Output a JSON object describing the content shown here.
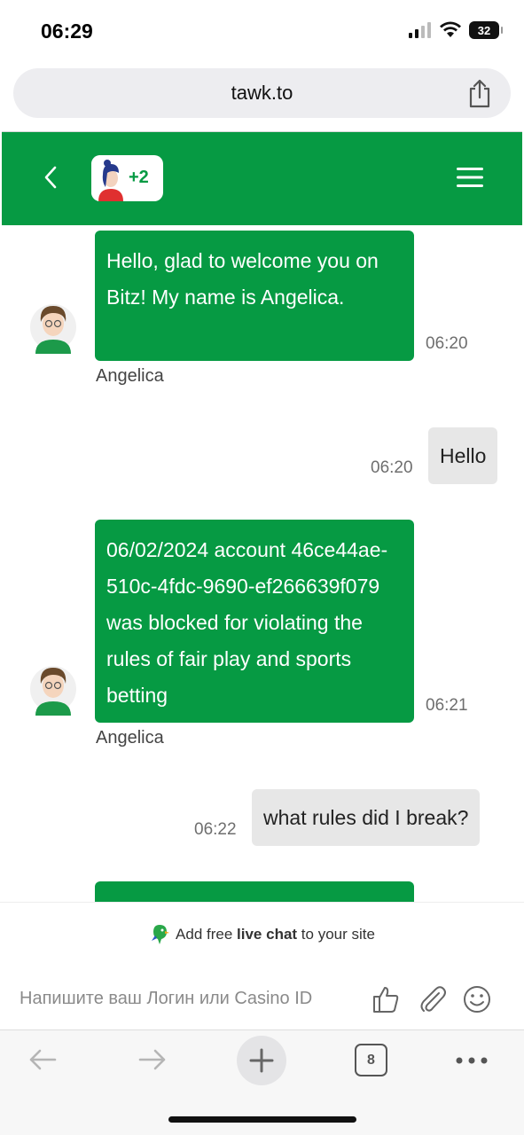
{
  "status_bar": {
    "time": "06:29",
    "battery": "32"
  },
  "browser": {
    "url": "tawk.to",
    "tab_count": "8"
  },
  "chat_header": {
    "agents_extra": "+2"
  },
  "messages": [
    {
      "direction": "in",
      "text": "Hello, glad to welcome you on Bitz! My name is Angelica.",
      "time": "06:20",
      "sender": "Angelica"
    },
    {
      "direction": "out",
      "text": "Hello",
      "time": "06:20"
    },
    {
      "direction": "in",
      "text": "06/02/2024 account 46ce44ae-510c-4fdc-9690-ef266639f079 was blocked for violating the rules of fair play and sports betting",
      "time": "06:21",
      "sender": "Angelica"
    },
    {
      "direction": "out",
      "text": "what rules did I break?",
      "time": "06:22"
    }
  ],
  "branding": {
    "prefix": "Add free ",
    "bold": "live chat",
    "suffix": " to your site"
  },
  "input": {
    "placeholder": "Напишите ваш Логин или Casino ID"
  },
  "colors": {
    "brand_green": "#069a43",
    "outgoing_bubble": "#e7e7e7"
  }
}
